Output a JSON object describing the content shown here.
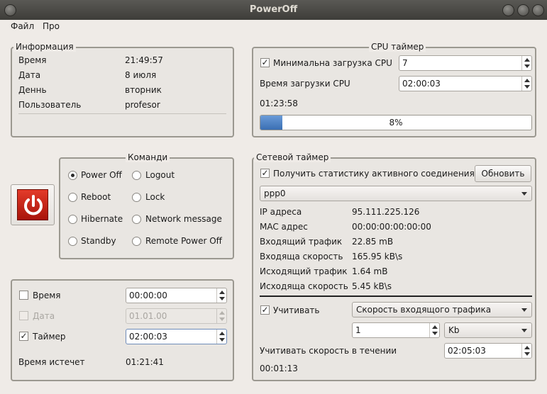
{
  "window": {
    "title": "PowerOff"
  },
  "menu": [
    "Файл",
    "Про"
  ],
  "info": {
    "title": "Информация",
    "rows": [
      {
        "label": "Время",
        "value": "21:49:57"
      },
      {
        "label": "Дата",
        "value": "8 июля"
      },
      {
        "label": "Деннь",
        "value": "вторник"
      },
      {
        "label": "Пользователь",
        "value": "profesor"
      }
    ]
  },
  "commands": {
    "title": "Команди",
    "options": [
      {
        "label": "Power Off",
        "selected": true
      },
      {
        "label": "Logout",
        "selected": false
      },
      {
        "label": "Reboot",
        "selected": false
      },
      {
        "label": "Lock",
        "selected": false
      },
      {
        "label": "Hibernate",
        "selected": false
      },
      {
        "label": "Network message",
        "selected": false
      },
      {
        "label": "Standby",
        "selected": false
      },
      {
        "label": "Remote Power Off",
        "selected": false
      }
    ],
    "power_icon": "power-icon"
  },
  "timer": {
    "time_label": "Время",
    "time_value": "00:00:00",
    "time_checked": false,
    "date_label": "Дата",
    "date_value": "01.01.00",
    "date_checked": false,
    "timer_label": "Таймер",
    "timer_value": "02:00:03",
    "timer_checked": true,
    "expires_label": "Время истечет",
    "expires_value": "01:21:41"
  },
  "cpu": {
    "title": "CPU таймер",
    "min_load_label": "Минимальна загрузка CPU",
    "min_load_checked": true,
    "min_load_value": "7",
    "load_time_label": "Время загрузки CPU",
    "load_time_value": "02:00:03",
    "elapsed": "01:23:58",
    "progress_text": "8%",
    "progress": 0.08
  },
  "network": {
    "title": "Сетевой таймер",
    "stats_label": "Получить статистику активного соединения",
    "stats_checked": true,
    "refresh_label": "Обновить",
    "interface": "ppp0",
    "rows": [
      {
        "label": "IP адреса",
        "value": "95.111.225.126"
      },
      {
        "label": "MAC адрес",
        "value": "00:00:00:00:00:00"
      },
      {
        "label": "Входящий трафик",
        "value": "22.85 mB"
      },
      {
        "label": "Входяща скорость",
        "value": "165.95 kB\\s"
      },
      {
        "label": "Исходящий  трафик",
        "value": "1.64 mB"
      },
      {
        "label": "Исходяща скорость",
        "value": "5.45 kB\\s"
      }
    ],
    "consider_label": "Учитивать",
    "consider_checked": true,
    "consider_option": "Скорость входящого трафика",
    "threshold_value": "1",
    "unit": "Kb",
    "duration_label": "Учитивать скорость в течении",
    "duration_value": "02:05:03",
    "elapsed": "00:01:13"
  }
}
